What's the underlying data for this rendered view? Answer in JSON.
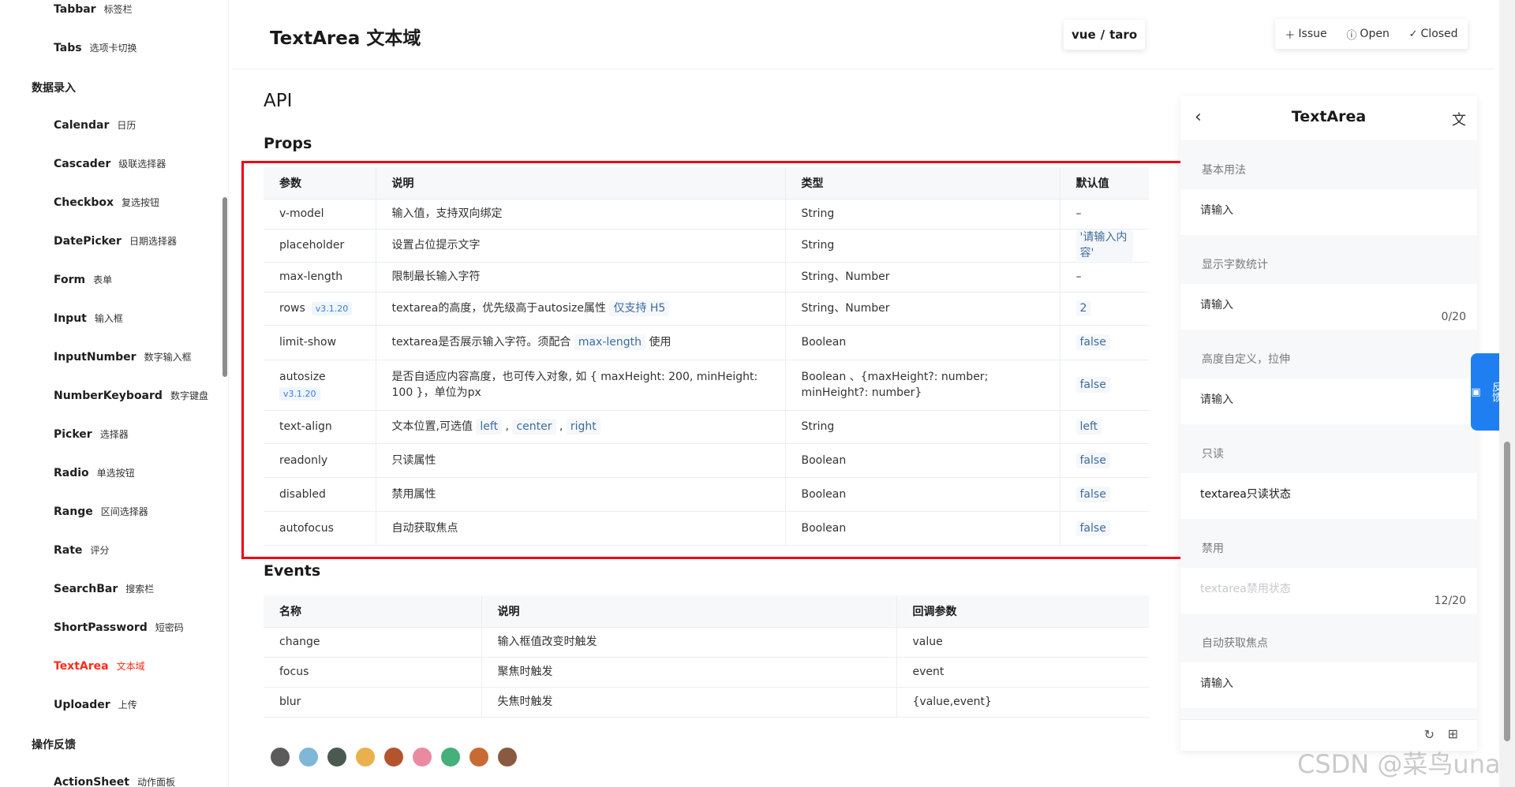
{
  "sidebar": {
    "items": [
      {
        "en": "Tabbar",
        "cn": "标签栏"
      },
      {
        "en": "Tabs",
        "cn": "选项卡切换"
      },
      {
        "group": "数据录入"
      },
      {
        "en": "Calendar",
        "cn": "日历"
      },
      {
        "en": "Cascader",
        "cn": "级联选择器"
      },
      {
        "en": "Checkbox",
        "cn": "复选按钮"
      },
      {
        "en": "DatePicker",
        "cn": "日期选择器"
      },
      {
        "en": "Form",
        "cn": "表单"
      },
      {
        "en": "Input",
        "cn": "输入框"
      },
      {
        "en": "InputNumber",
        "cn": "数字输入框"
      },
      {
        "en": "NumberKeyboard",
        "cn": "数字键盘"
      },
      {
        "en": "Picker",
        "cn": "选择器"
      },
      {
        "en": "Radio",
        "cn": "单选按钮"
      },
      {
        "en": "Range",
        "cn": "区间选择器"
      },
      {
        "en": "Rate",
        "cn": "评分"
      },
      {
        "en": "SearchBar",
        "cn": "搜索栏"
      },
      {
        "en": "ShortPassword",
        "cn": "短密码"
      },
      {
        "en": "TextArea",
        "cn": "文本域",
        "active": true
      },
      {
        "en": "Uploader",
        "cn": "上传"
      },
      {
        "group": "操作反馈"
      },
      {
        "en": "ActionSheet",
        "cn": "动作面板"
      }
    ]
  },
  "header": {
    "title": "TextArea 文本域",
    "switch": {
      "left": "vue",
      "sep": "/",
      "right": "taro"
    },
    "issue": "Issue",
    "open": "Open",
    "closed": "Closed"
  },
  "content": {
    "api": "API",
    "props_title": "Props",
    "events_title": "Events",
    "props": {
      "headers": [
        "参数",
        "说明",
        "类型",
        "默认值"
      ],
      "rows": [
        {
          "name": "v-model",
          "desc": [
            {
              "t": "输入值，支持双向绑定"
            }
          ],
          "type": "String",
          "def": "–",
          "def_tag": false
        },
        {
          "name": "placeholder",
          "desc": [
            {
              "t": "设置占位提示文字"
            }
          ],
          "type": "String",
          "def": "'请输入内容'",
          "def_tag": true
        },
        {
          "name": "max-length",
          "desc": [
            {
              "t": "限制最长输入字符"
            }
          ],
          "type": "String、Number",
          "def": "–",
          "def_tag": false
        },
        {
          "name": "rows",
          "ver": "v3.1.20",
          "desc": [
            {
              "t": "textarea的高度，优先级高于autosize属性 "
            },
            {
              "tag": "仅支持 H5"
            }
          ],
          "type": "String、Number",
          "def": "2",
          "def_tag": true
        },
        {
          "name": "limit-show",
          "desc": [
            {
              "t": "textarea是否展示输入字符。须配合 "
            },
            {
              "tag": "max-length"
            },
            {
              "t": " 使用"
            }
          ],
          "type": "Boolean",
          "def": "false",
          "def_tag": true
        },
        {
          "name": "autosize",
          "ver": "v3.1.20",
          "ver_block": true,
          "desc": [
            {
              "t": "是否自适应内容高度，也可传入对象, 如 { maxHeight: 200, minHeight: 100 }，单位为px"
            }
          ],
          "type": "Boolean 、{maxHeight?: number; minHeight?: number}",
          "def": "false",
          "def_tag": true
        },
        {
          "name": "text-align",
          "desc": [
            {
              "t": "文本位置,可选值 "
            },
            {
              "tag": "left"
            },
            {
              "t": " , "
            },
            {
              "tag": "center"
            },
            {
              "t": " , "
            },
            {
              "tag": "right"
            }
          ],
          "type": "String",
          "def": "left",
          "def_tag": true
        },
        {
          "name": "readonly",
          "desc": [
            {
              "t": "只读属性"
            }
          ],
          "type": "Boolean",
          "def": "false",
          "def_tag": true
        },
        {
          "name": "disabled",
          "desc": [
            {
              "t": "禁用属性"
            }
          ],
          "type": "Boolean",
          "def": "false",
          "def_tag": true
        },
        {
          "name": "autofocus",
          "desc": [
            {
              "t": "自动获取焦点"
            }
          ],
          "type": "Boolean",
          "def": "false",
          "def_tag": true
        }
      ]
    },
    "events": {
      "headers": [
        "名称",
        "说明",
        "回调参数"
      ],
      "rows": [
        [
          "change",
          "输入框值改变时触发",
          "value"
        ],
        [
          "focus",
          "聚焦时触发",
          "event"
        ],
        [
          "blur",
          "失焦时触发",
          "{value,event}"
        ]
      ]
    },
    "avatar_colors": [
      "#5b5b5b",
      "#7fb7d6",
      "#4a5a50",
      "#e9b04d",
      "#b4542f",
      "#e98aa0",
      "#46b07a",
      "#c86a33",
      "#8a5a40"
    ]
  },
  "preview": {
    "title": "TextArea",
    "sections": [
      {
        "title": "基本用法",
        "value": "请输入",
        "count": "",
        "kind": "normal"
      },
      {
        "title": "显示字数统计",
        "value": "请输入",
        "count": "0/20",
        "kind": "normal"
      },
      {
        "title": "高度自定义，拉伸",
        "value": "请输入",
        "count": "",
        "kind": "normal"
      },
      {
        "title": "只读",
        "value": "textarea只读状态",
        "count": "",
        "kind": "readonly"
      },
      {
        "title": "禁用",
        "value": "textarea禁用状态",
        "count": "12/20",
        "kind": "disabled"
      },
      {
        "title": "自动获取焦点",
        "value": "请输入",
        "count": "",
        "kind": "normal"
      }
    ]
  },
  "feedback": "反馈",
  "watermark": "CSDN @菜鸟una",
  "colors": {
    "accent": "#fa2c19",
    "highlight": "#f00010",
    "feedback": "#1f7ff0"
  }
}
